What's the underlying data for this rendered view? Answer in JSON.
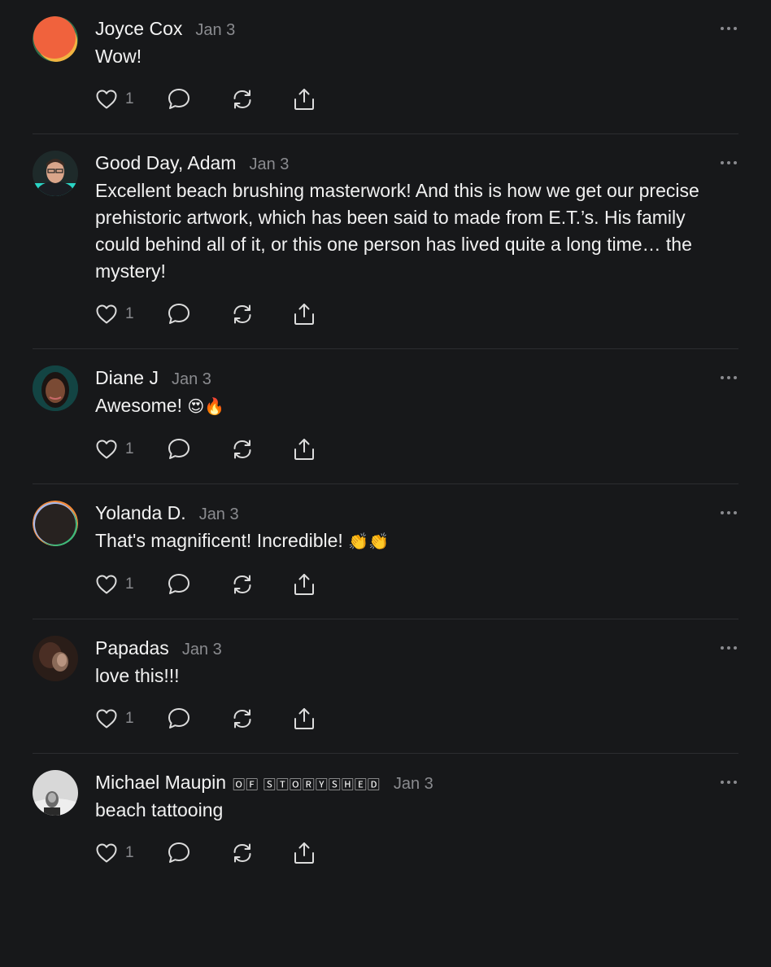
{
  "colors": {
    "background": "#17181a",
    "text": "#f1f1f1",
    "muted": "#8a8b8f",
    "divider": "#2c2d30"
  },
  "comments": [
    {
      "author": "Joyce Cox",
      "badge": "",
      "date": "Jan 3",
      "text": "Wow!",
      "emoji": "",
      "likes": "1",
      "avatar": "joyce-cox-avatar"
    },
    {
      "author": "Good Day, Adam",
      "badge": "",
      "date": "Jan 3",
      "text": "Excellent beach brushing masterwork! And this is how we get our precise prehistoric artwork, which has been said to made from E.T.’s. His family could behind all of it, or this one person has lived quite a long time… the mystery!",
      "emoji": "",
      "likes": "1",
      "avatar": "adam-avatar"
    },
    {
      "author": "Diane J",
      "badge": "",
      "date": "Jan 3",
      "text": "Awesome!",
      "emoji": "😍🔥",
      "likes": "1",
      "avatar": "diane-avatar"
    },
    {
      "author": "Yolanda D.",
      "badge": "",
      "date": "Jan 3",
      "text": "That's magnificent! Incredible!",
      "emoji": "👏👏",
      "likes": "1",
      "avatar": "yolanda-avatar"
    },
    {
      "author": "Papadas",
      "badge": "",
      "date": "Jan 3",
      "text": "love this!!!",
      "emoji": "",
      "likes": "1",
      "avatar": "papadas-avatar"
    },
    {
      "author": "Michael Maupin",
      "badge": "🄾🄵 🅂🅃🄾🅁🅈🅂🄷🄴🄳",
      "date": "Jan 3",
      "text": "beach tattooing",
      "emoji": "",
      "likes": "1",
      "avatar": "michael-avatar"
    }
  ]
}
